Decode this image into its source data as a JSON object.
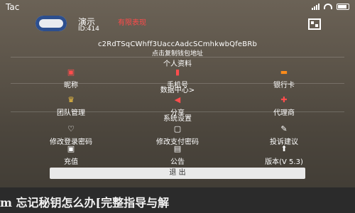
{
  "status_bar": {
    "time": "Tac"
  },
  "profile": {
    "nickname": "演示",
    "vip_text": "有限表现",
    "uid": "ID:414"
  },
  "wallet": {
    "address": "c2RdTSqCWhff3UaccAadcSCmhkwbQfeBRb",
    "copy_hint": "点击复制钱包地址"
  },
  "sections": {
    "personal": "个人资料",
    "data_center": "数据中心>",
    "system": "系统设置"
  },
  "personal_items": [
    {
      "label": "昵称",
      "icon": "nickname-icon",
      "color": "#ff4d4d"
    },
    {
      "label": "手机号",
      "icon": "phone-icon",
      "color": "#ff4d4d"
    },
    {
      "label": "银行卡",
      "icon": "bank-card-icon",
      "color": "#ff8c1a"
    }
  ],
  "data_items": [
    {
      "label": "团队管理",
      "icon": "crown-icon",
      "color": "#f5c542"
    },
    {
      "label": "分享",
      "icon": "share-icon",
      "color": "#ff4d4d"
    },
    {
      "label": "代理商",
      "icon": "agent-icon",
      "color": "#ff4d4d"
    }
  ],
  "system_items_row1": [
    {
      "label": "修改登录密码",
      "icon": "lock-icon"
    },
    {
      "label": "修改支付密码",
      "icon": "pay-password-icon"
    },
    {
      "label": "投诉建议",
      "icon": "feedback-icon"
    }
  ],
  "system_items_row2": [
    {
      "label": "充值",
      "icon": "recharge-icon"
    },
    {
      "label": "公告",
      "icon": "announcement-icon"
    },
    {
      "label": "版本(V 5.3)",
      "icon": "version-icon"
    }
  ],
  "logout_label": "退    出",
  "bottom_banner": "m 忘记秘钥怎么办[完整指导与解"
}
